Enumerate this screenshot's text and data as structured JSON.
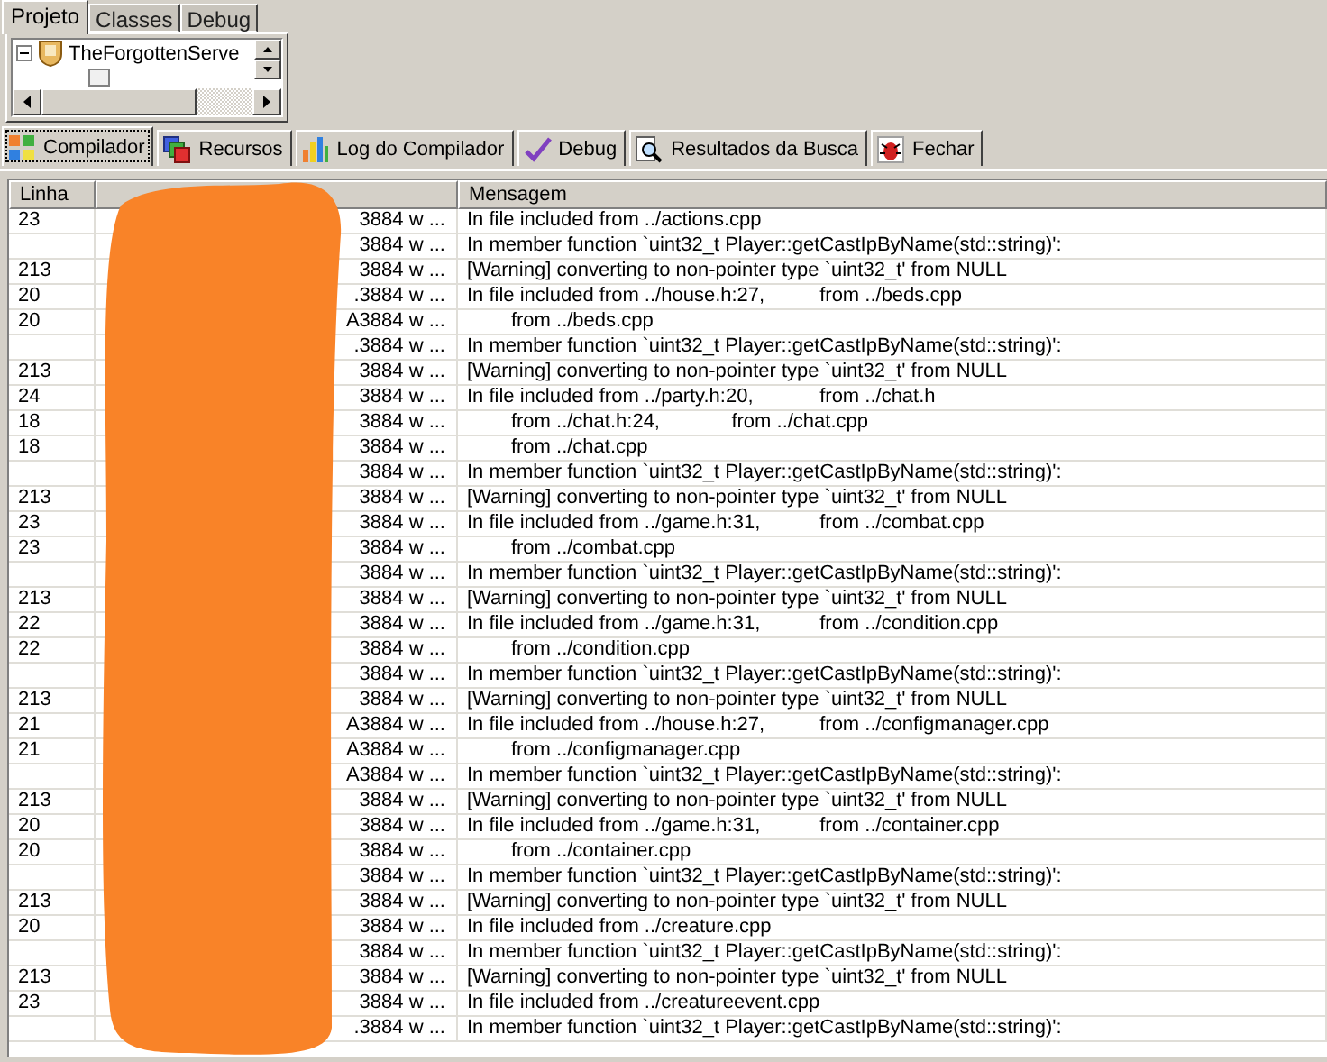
{
  "project_panel": {
    "tabs": [
      {
        "label": "Projeto",
        "selected": true
      },
      {
        "label": "Classes",
        "selected": false
      },
      {
        "label": "Debug",
        "selected": false
      }
    ],
    "tree": [
      {
        "label": "TheForgottenServe",
        "expanded": true
      }
    ]
  },
  "bottom_tabs": [
    {
      "label": "Compilador",
      "selected": true
    },
    {
      "label": "Recursos",
      "selected": false
    },
    {
      "label": "Log do Compilador",
      "selected": false
    },
    {
      "label": "Debug",
      "selected": false
    },
    {
      "label": "Resultados da Busca",
      "selected": false
    },
    {
      "label": "Fechar",
      "selected": false
    }
  ],
  "log_table": {
    "columns": [
      "Linha",
      "Mensagem"
    ],
    "rows": [
      {
        "line": "23",
        "unit": "3884 w ...",
        "message": "In file included from ../actions.cpp"
      },
      {
        "line": "",
        "unit": "3884 w ...",
        "message": "In member function `uint32_t Player::getCastIpByName(std::string)':"
      },
      {
        "line": "213",
        "unit": "3884 w ...",
        "message": "[Warning] converting to non-pointer type `uint32_t' from NULL"
      },
      {
        "line": "20",
        "unit": ".3884 w ...",
        "message": "In file included from ../house.h:27,\t\tfrom ../beds.cpp"
      },
      {
        "line": "20",
        "unit": "A3884 w ...",
        "message": "\tfrom ../beds.cpp"
      },
      {
        "line": "",
        "unit": ".3884 w ...",
        "message": "In member function `uint32_t Player::getCastIpByName(std::string)':"
      },
      {
        "line": "213",
        "unit": "3884 w ...",
        "message": "[Warning] converting to non-pointer type `uint32_t' from NULL"
      },
      {
        "line": "24",
        "unit": "3884 w ...",
        "message": "In file included from ../party.h:20,\t\tfrom ../chat.h"
      },
      {
        "line": "18",
        "unit": "3884 w ...",
        "message": "\tfrom ../chat.h:24,\t\tfrom ../chat.cpp"
      },
      {
        "line": "18",
        "unit": "3884 w ...",
        "message": "\tfrom ../chat.cpp"
      },
      {
        "line": "",
        "unit": "3884 w ...",
        "message": "In member function `uint32_t Player::getCastIpByName(std::string)':"
      },
      {
        "line": "213",
        "unit": "3884 w ...",
        "message": "[Warning] converting to non-pointer type `uint32_t' from NULL"
      },
      {
        "line": "23",
        "unit": "3884 w ...",
        "message": "In file included from ../game.h:31,\t\tfrom ../combat.cpp"
      },
      {
        "line": "23",
        "unit": "3884 w ...",
        "message": "\tfrom ../combat.cpp"
      },
      {
        "line": "",
        "unit": "3884 w ...",
        "message": "In member function `uint32_t Player::getCastIpByName(std::string)':"
      },
      {
        "line": "213",
        "unit": "3884 w ...",
        "message": "[Warning] converting to non-pointer type `uint32_t' from NULL"
      },
      {
        "line": "22",
        "unit": "3884 w ...",
        "message": "In file included from ../game.h:31,\t\tfrom ../condition.cpp"
      },
      {
        "line": "22",
        "unit": "3884 w ...",
        "message": "\tfrom ../condition.cpp"
      },
      {
        "line": "",
        "unit": "3884 w ...",
        "message": "In member function `uint32_t Player::getCastIpByName(std::string)':"
      },
      {
        "line": "213",
        "unit": "3884 w ...",
        "message": "[Warning] converting to non-pointer type `uint32_t' from NULL"
      },
      {
        "line": "21",
        "unit": "A3884 w ...",
        "message": "In file included from ../house.h:27,\t\tfrom ../configmanager.cpp"
      },
      {
        "line": "21",
        "unit": "A3884 w ...",
        "message": "\tfrom ../configmanager.cpp"
      },
      {
        "line": "",
        "unit": "A3884 w ...",
        "message": "In member function `uint32_t Player::getCastIpByName(std::string)':"
      },
      {
        "line": "213",
        "unit": "3884 w ...",
        "message": "[Warning] converting to non-pointer type `uint32_t' from NULL"
      },
      {
        "line": "20",
        "unit": "3884 w ...",
        "message": "In file included from ../game.h:31,\t\tfrom ../container.cpp"
      },
      {
        "line": "20",
        "unit": "3884 w ...",
        "message": "\tfrom ../container.cpp"
      },
      {
        "line": "",
        "unit": "3884 w ...",
        "message": "In member function `uint32_t Player::getCastIpByName(std::string)':"
      },
      {
        "line": "213",
        "unit": "3884 w ...",
        "message": "[Warning] converting to non-pointer type `uint32_t' from NULL"
      },
      {
        "line": "20",
        "unit": "3884 w ...",
        "message": "In file included from ../creature.cpp"
      },
      {
        "line": "",
        "unit": "3884 w ...",
        "message": "In member function `uint32_t Player::getCastIpByName(std::string)':"
      },
      {
        "line": "213",
        "unit": "3884 w ...",
        "message": "[Warning] converting to non-pointer type `uint32_t' from NULL"
      },
      {
        "line": "23",
        "unit": "3884 w ...",
        "message": "In file included from ../creatureevent.cpp"
      },
      {
        "line": "",
        "unit": ".3884 w ...",
        "message": "In member function `uint32_t Player::getCastIpByName(std::string)':"
      }
    ]
  }
}
